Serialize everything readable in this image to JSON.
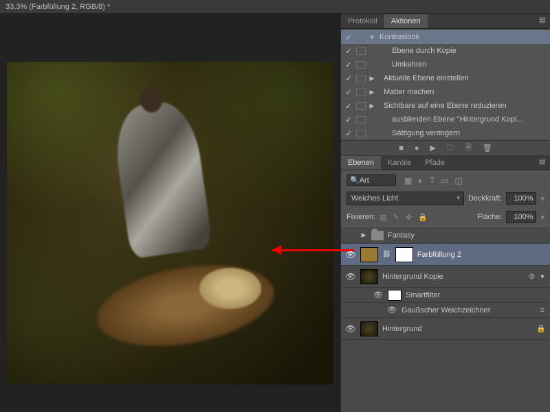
{
  "titlebar": "33,3% (Farbfüllung 2, RGB/8) *",
  "panel1": {
    "tabs": [
      "Protokoll",
      "Aktionen"
    ],
    "active": 1,
    "actions": {
      "set": "Kontraslook",
      "items": [
        "Ebene durch Kopie",
        "Umkehren",
        "Aktuelle Ebene einstellen",
        "Matter machen",
        "Sichtbare auf eine Ebene reduzieren",
        "ausblenden Ebene \"Hintergrund Kopi...",
        "Sättigung verringern"
      ],
      "disclosed": [
        false,
        false,
        true,
        true,
        false,
        false,
        false
      ]
    }
  },
  "panel2": {
    "tabs": [
      "Ebenen",
      "Kanäle",
      "Pfade"
    ],
    "active": 0,
    "search_placeholder": "Art",
    "blend_mode": "Weiches Licht",
    "opacity_label": "Deckkraft:",
    "opacity_value": "100%",
    "fill_label": "Fläche:",
    "fill_value": "100%",
    "lock_label": "Fixieren:",
    "layers": {
      "group": "Fantasy",
      "l1": "Farbfüllung 2",
      "l2": "Hintergrund Kopie",
      "sf": "Smartfilter",
      "sf_item": "Gaußscher Weichzeichner",
      "l3": "Hintergrund"
    }
  }
}
